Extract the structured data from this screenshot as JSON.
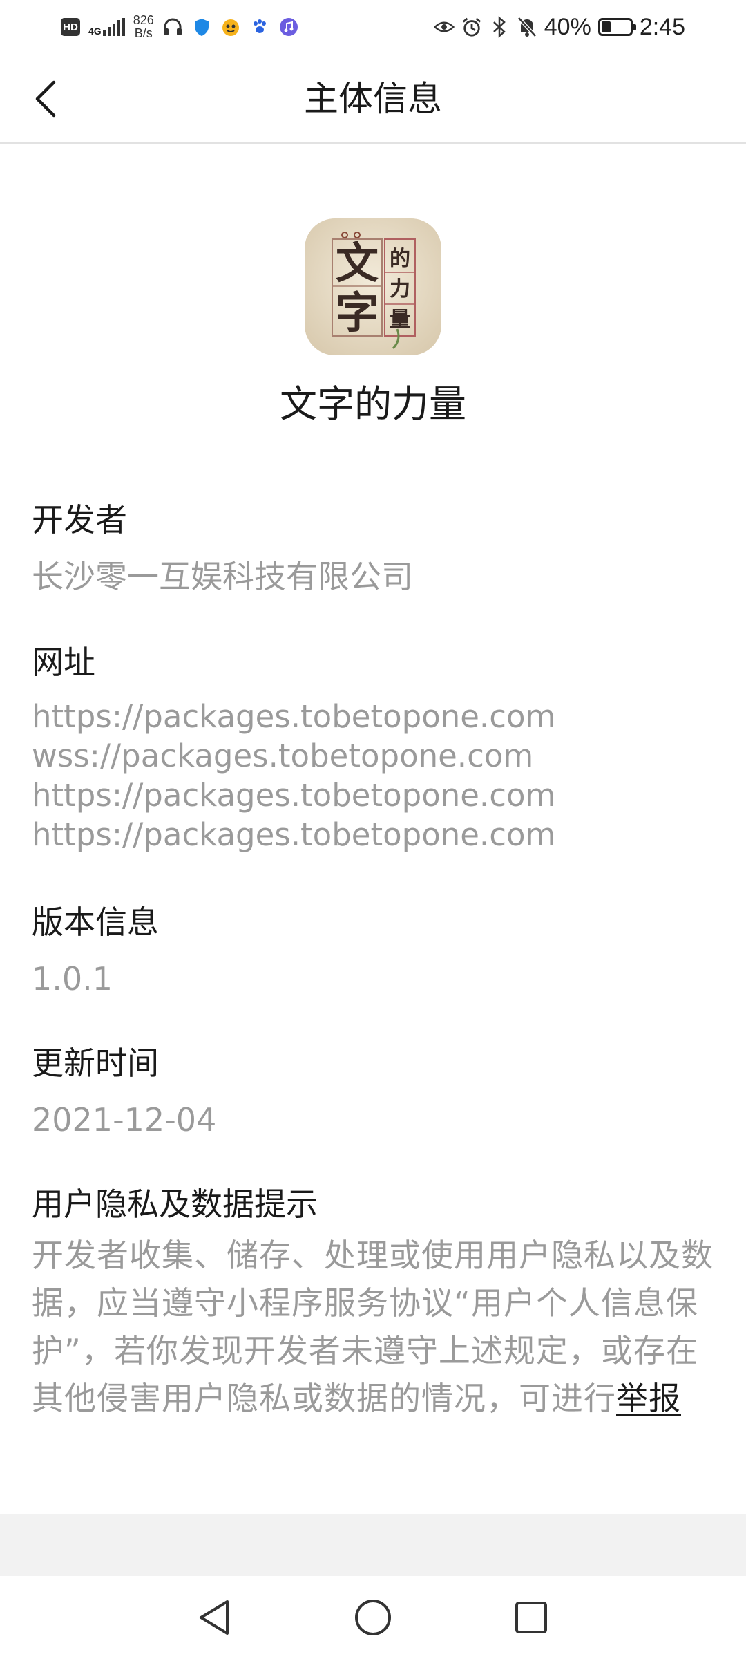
{
  "status_bar": {
    "network_type": "4G",
    "net_speed_value": "826",
    "net_speed_unit": "B/s",
    "battery": "40%",
    "battery_level": 0.4,
    "time": "2:45"
  },
  "header": {
    "title": "主体信息",
    "back_icon": "chevron-left-icon"
  },
  "app": {
    "name": "文字的力量",
    "icon_glyphs": {
      "large_top": "文",
      "large_bottom": "字",
      "small_1": "的",
      "small_2": "力",
      "small_3": "量"
    }
  },
  "developer": {
    "label": "开发者",
    "value": "长沙零一互娱科技有限公司"
  },
  "urls": {
    "label": "网址",
    "items": [
      "https://packages.tobetopone.com",
      "wss://packages.tobetopone.com",
      "https://packages.tobetopone.com",
      "https://packages.tobetopone.com"
    ]
  },
  "version": {
    "label": "版本信息",
    "value": "1.0.1"
  },
  "update_time": {
    "label": "更新时间",
    "value": "2021-12-04"
  },
  "privacy": {
    "label": "用户隐私及数据提示",
    "text": "开发者收集、储存、处理或使用用户隐私以及数据，应当遵守小程序服务协议“用户个人信息保护”，若你发现开发者未遵守上述规定，或存在其他侵害用户隐私或数据的情况，可进行",
    "report_link": "举报"
  },
  "nav_bar": {
    "back_icon": "triangle-back-icon",
    "home_icon": "circle-home-icon",
    "recents_icon": "square-recents-icon"
  },
  "colors": {
    "primary_text": "#1a1a1a",
    "secondary_text": "#9a9a9a",
    "divider": "#e2e2e2",
    "footer_band": "#f2f2f2"
  }
}
